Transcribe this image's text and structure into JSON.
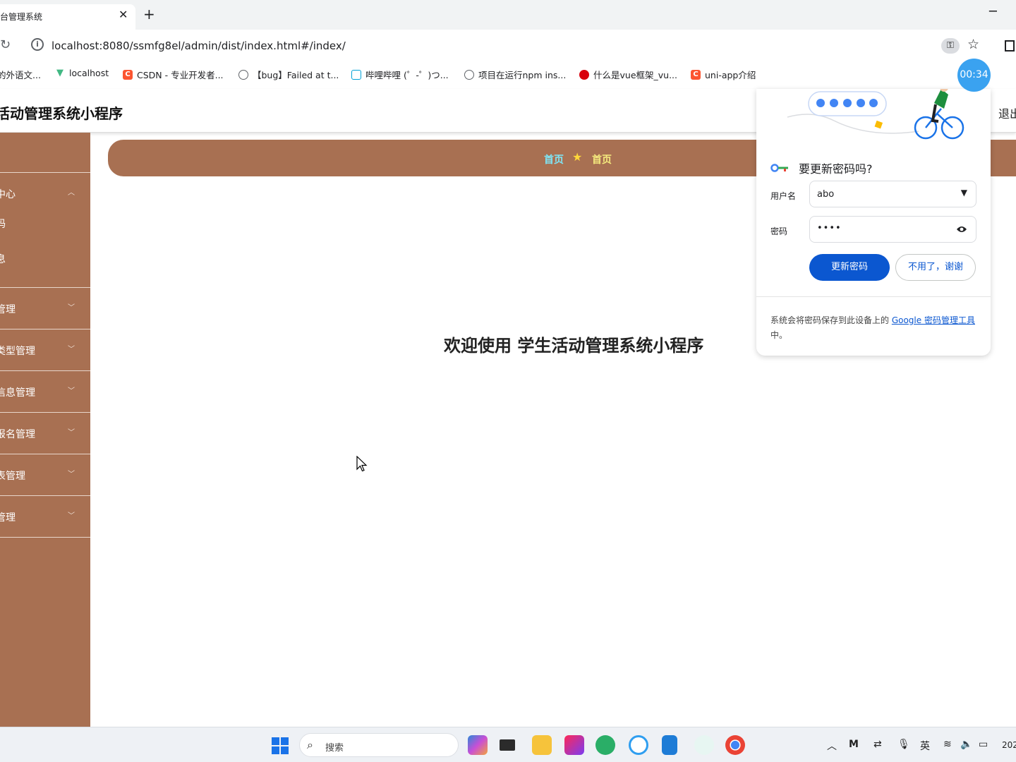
{
  "browser": {
    "tab_title": "台管理系统",
    "tab_close": "✕",
    "new_tab": "+",
    "window_minimize": "─",
    "url": "localhost:8080/ssmfg8el/admin/dist/index.html#/index/",
    "bookmarks": [
      {
        "label": "的外语文...",
        "icon": "doc-icon",
        "color": "#4285f4"
      },
      {
        "label": "localhost",
        "icon": "vue-logo-icon",
        "color": "#41b883"
      },
      {
        "label": "CSDN - 专业开发者...",
        "icon": "csdn-icon",
        "color": "#fc5531"
      },
      {
        "label": "【bug】Failed at t...",
        "icon": "globe-icon",
        "color": "#5f6368"
      },
      {
        "label": "哔哩哔哩 (゜-゜)つ...",
        "icon": "bilibili-icon",
        "color": "#00a1d6"
      },
      {
        "label": "项目在运行npm ins...",
        "icon": "globe-icon",
        "color": "#5f6368"
      },
      {
        "label": "什么是vue框架_vu...",
        "icon": "runoob-icon",
        "color": "#d8000c"
      },
      {
        "label": "uni-app介绍",
        "icon": "csdn-icon",
        "color": "#fc5531"
      }
    ]
  },
  "header": {
    "title": "活动管理系统小程序",
    "logout": "退出"
  },
  "sidebar": {
    "groups": [
      {
        "label": "中心",
        "expanded": true,
        "children": [
          "码",
          "息"
        ]
      },
      {
        "label": "管理",
        "expanded": false
      },
      {
        "label": "类型管理",
        "expanded": false
      },
      {
        "label": "信息管理",
        "expanded": false
      },
      {
        "label": "报名管理",
        "expanded": false
      },
      {
        "label": "表管理",
        "expanded": false
      },
      {
        "label": "管理",
        "expanded": false
      }
    ]
  },
  "breadcrumb": {
    "first": "首页",
    "separator": "★",
    "current": "首页"
  },
  "main": {
    "welcome": "欢迎使用 学生活动管理系统小程序"
  },
  "password_popup": {
    "title": "要更新密码吗?",
    "username_label": "用户名",
    "username_value": "abo",
    "password_label": "密码",
    "password_value": "••••",
    "update_button": "更新密码",
    "decline_button": "不用了，谢谢",
    "footer_prefix": "系统会将密码保存到此设备上的 ",
    "footer_link": "Google 密码管理工具",
    "footer_suffix": "中。"
  },
  "timer": "00:34",
  "taskbar": {
    "search_placeholder": "搜索",
    "ime": "英",
    "clock_partial": "202"
  }
}
